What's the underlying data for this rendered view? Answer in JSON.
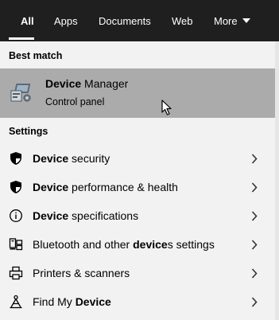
{
  "tabs": [
    {
      "label": "All",
      "active": true
    },
    {
      "label": "Apps"
    },
    {
      "label": "Documents"
    },
    {
      "label": "Web"
    },
    {
      "label": "More"
    }
  ],
  "best_match": {
    "heading": "Best match",
    "title_bold": "Device",
    "title_rest": " Manager",
    "subtitle": "Control panel",
    "icon": "device-manager-icon",
    "highlight_color": "#ababab"
  },
  "settings": {
    "heading": "Settings",
    "items": [
      {
        "icon": "shield-icon",
        "pre": "",
        "bold": "Device",
        "post": " security"
      },
      {
        "icon": "shield-icon",
        "pre": "",
        "bold": "Device",
        "post": " performance & health"
      },
      {
        "icon": "info-icon",
        "pre": "",
        "bold": "Device",
        "post": " specifications"
      },
      {
        "icon": "devices-icon",
        "pre": "Bluetooth and other ",
        "bold": "device",
        "post": "s settings"
      },
      {
        "icon": "printer-icon",
        "pre": "Printers & scanners",
        "bold": "",
        "post": ""
      },
      {
        "icon": "find-device-icon",
        "pre": "Find My ",
        "bold": "Device",
        "post": ""
      }
    ]
  },
  "colors": {
    "tabbar_bg": "#1f1f1f",
    "panel_bg": "#f2f2f2"
  }
}
